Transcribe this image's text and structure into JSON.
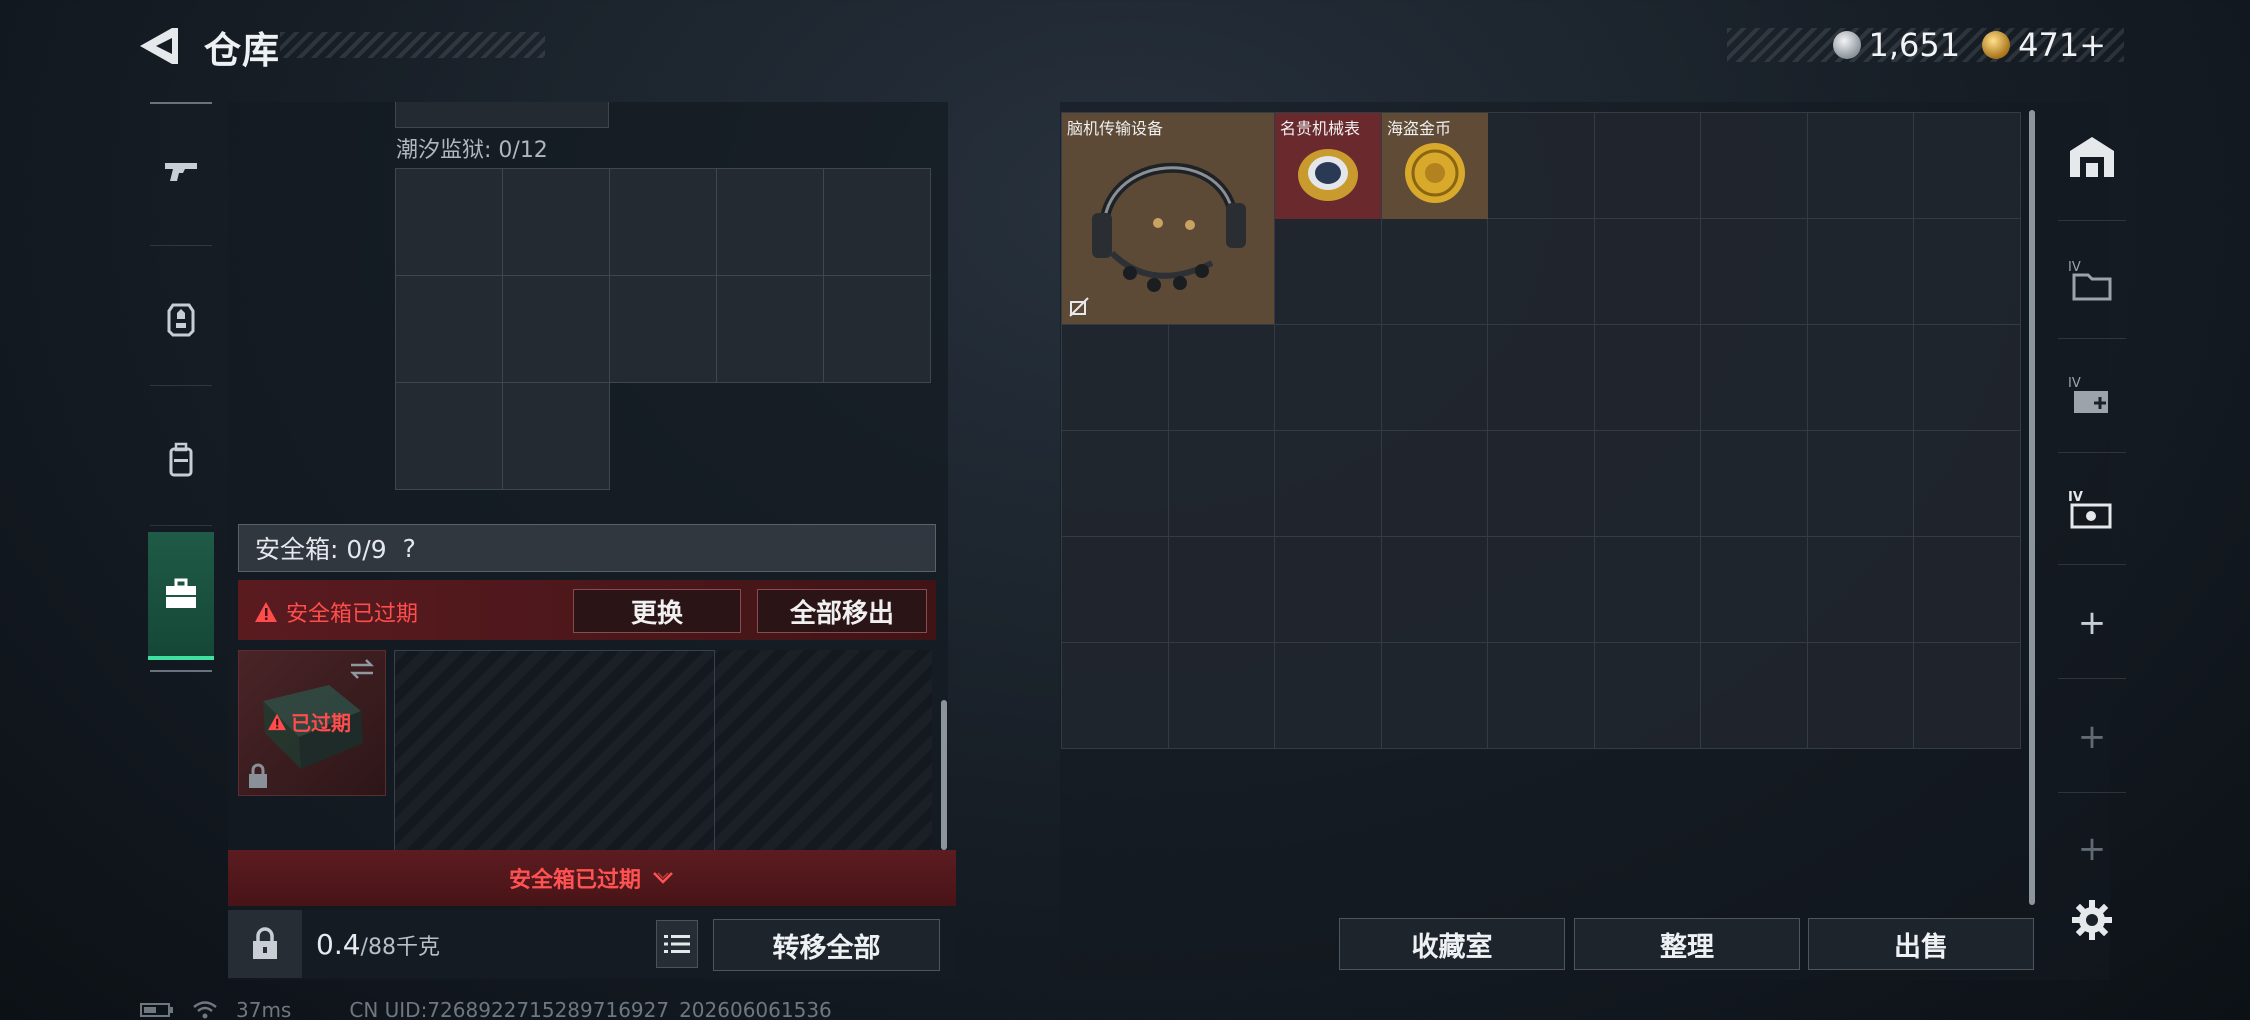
{
  "header": {
    "title": "仓库",
    "currency_silver": "1,651",
    "currency_gold": "471+"
  },
  "left": {
    "container_label": "潮汐监狱: 0/12",
    "safebox_label": "安全箱: 0/9",
    "safebox_help": "?",
    "expired_notice": "安全箱已过期",
    "replace_button": "更换",
    "move_all_out_button": "全部移出",
    "thumb_expired": "已过期",
    "bottom_expired": "安全箱已过期",
    "weight_value": "0.4",
    "weight_unit": "/88千克",
    "transfer_all_button": "转移全部"
  },
  "stash": {
    "items": [
      {
        "name": "脑机传输设备",
        "color": "#5c4a37"
      },
      {
        "name": "名贵机械表",
        "color": "#6a2a2d"
      },
      {
        "name": "海盗金币",
        "color": "#5f4b36"
      }
    ],
    "collection_button": "收藏室",
    "sort_button": "整理",
    "sell_button": "出售"
  },
  "status_bar": {
    "ping": "37ms",
    "uid": "CN UID:7268922715289716927_202606061536"
  },
  "icons": [
    "back-arrow-icon",
    "pistol-icon",
    "armor-icon",
    "backpack-icon",
    "briefcase-icon",
    "lock-icon",
    "list-icon",
    "gear-icon"
  ],
  "colors": {
    "accent_green": "#40e0a0",
    "alert_red": "#ff4c4c",
    "expired_bg": "#5a1b1f"
  }
}
